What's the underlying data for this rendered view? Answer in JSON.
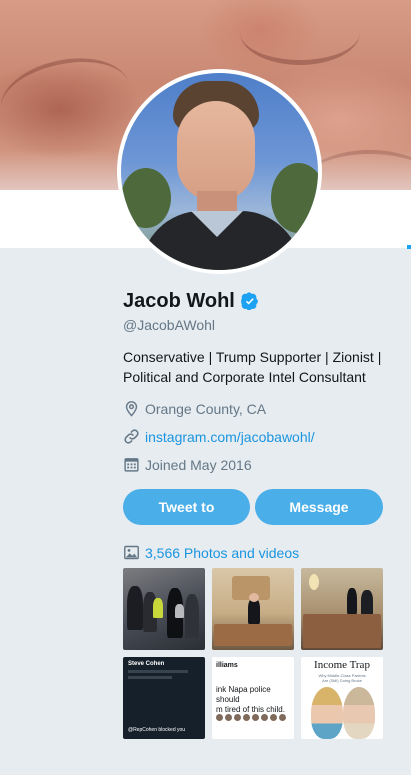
{
  "profile": {
    "name": "Jacob Wohl",
    "handle": "@JacobAWohl",
    "bio": [
      "Conservative | Trump Supporter | Zionist |",
      "Political and Corporate Intel Consultant"
    ],
    "location": "Orange County, CA",
    "website": "instagram.com/jacobawohl/",
    "joined": "Joined May 2016",
    "verified": true
  },
  "actions": {
    "tweet_to_label": "Tweet to",
    "message_label": "Message"
  },
  "media": {
    "label": "3,566 Photos and videos",
    "thumbnails": [
      {
        "icon": "photo-crowd-icon"
      },
      {
        "icon": "photo-whitehouse-icon"
      },
      {
        "icon": "photo-banquet-icon"
      },
      {
        "caption_title": "Steve Cohen",
        "caption_text": "@RepCohen blocked you"
      },
      {
        "caption_title": "illiams",
        "caption_text": "ink Napa police should\nm tired of this child."
      },
      {
        "caption_title": "Income Trap",
        "caption_text": "Why Middle-Class Parents\nAre (Still) Going Broke"
      }
    ]
  },
  "colors": {
    "accent": "#1da1f2",
    "link": "#1b95e0",
    "button": "#4aaee8",
    "background": "#e6ecf0",
    "muted": "#657786"
  }
}
